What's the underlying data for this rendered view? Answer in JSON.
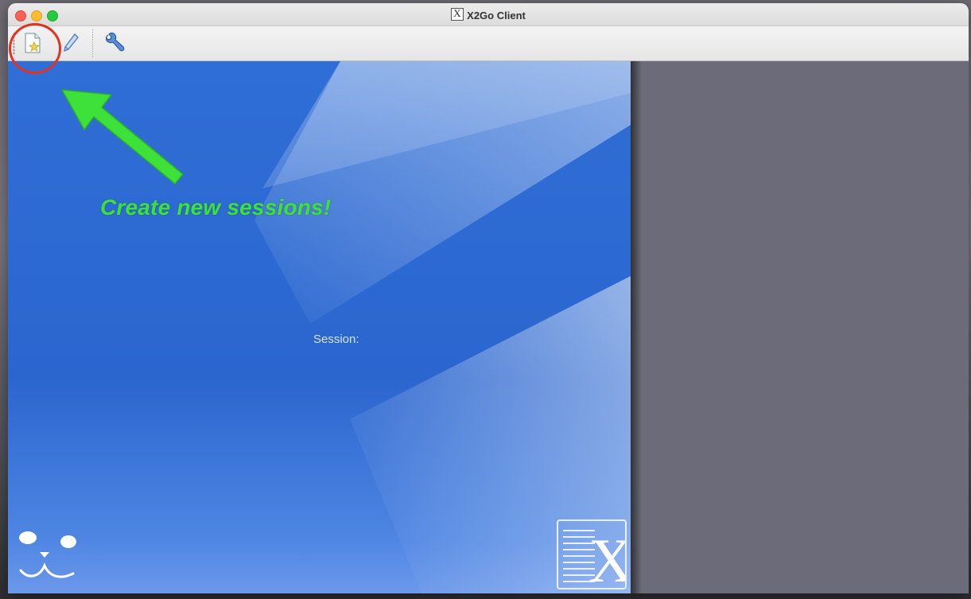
{
  "window": {
    "title": "X2Go Client"
  },
  "toolbar": {
    "items": [
      {
        "name": "new-session",
        "icon": "new-session-icon"
      },
      {
        "name": "edit-session",
        "icon": "pencil-icon"
      },
      {
        "name": "preferences",
        "icon": "wrench-icon"
      }
    ]
  },
  "annotation": {
    "text": "Create new sessions!",
    "color": "#3ee03a",
    "ring_color": "#e2331f"
  },
  "main": {
    "session_label": "Session:"
  },
  "colors": {
    "panel_blue": "#2f6ed6",
    "right_panel": "#6b6b7a"
  }
}
